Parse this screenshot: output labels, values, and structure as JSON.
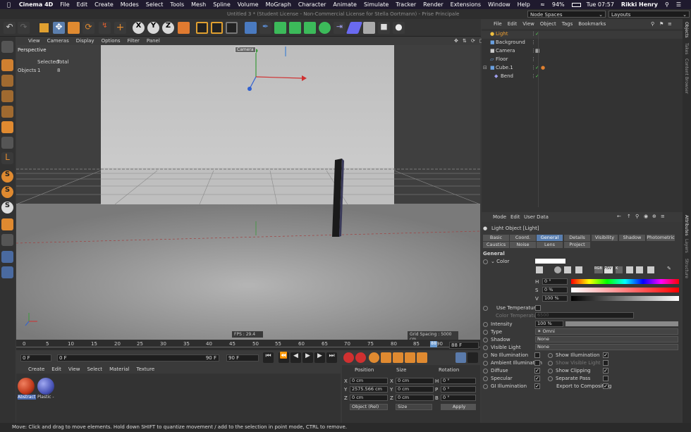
{
  "macmenu": {
    "apple": "",
    "app": "Cinema 4D",
    "items": [
      "File",
      "Edit",
      "Create",
      "Modes",
      "Select",
      "Tools",
      "Mesh",
      "Spline",
      "Volume",
      "MoGraph",
      "Character",
      "Animate",
      "Simulate",
      "Tracker",
      "Render",
      "Extensions",
      "Window",
      "Help"
    ],
    "battery": "94%",
    "clock": "Tue 07:57",
    "user": "Rikki Henry"
  },
  "window": {
    "title": "Untitled 3 * (Student License - Non-Commercial License for Stella Oortmann) - Prise Principale",
    "node_spaces": "Node Spaces",
    "layouts": "Layouts"
  },
  "viewport": {
    "menu": [
      "View",
      "Cameras",
      "Display",
      "Options",
      "Filter",
      "Panel"
    ],
    "label": "Perspective",
    "camera_tag": "Camera",
    "stats_header_selected": "Selected",
    "stats_header_total": "Total",
    "stats_row_label": "Objects",
    "stats_selected": "1",
    "stats_total": "8",
    "fps": "FPS : 29.4",
    "grid": "Grid Spacing : 5000 cm"
  },
  "timeline": {
    "ticks": [
      "0",
      "5",
      "10",
      "15",
      "20",
      "25",
      "30",
      "35",
      "40",
      "45",
      "50",
      "55",
      "60",
      "65",
      "70",
      "75",
      "80",
      "85",
      "88",
      "90"
    ],
    "current_badge": "88 F",
    "start": "0 F",
    "start2": "0 F",
    "end": "90 F",
    "end2": "90 F"
  },
  "materials": {
    "menu": [
      "Create",
      "Edit",
      "View",
      "Select",
      "Material",
      "Texture"
    ],
    "items": [
      {
        "name": "Abstract",
        "color": "#c0391b"
      },
      {
        "name": "Plastic -",
        "color": "#4a55b8"
      }
    ]
  },
  "coords": {
    "headers": [
      "Position",
      "Size",
      "Rotation"
    ],
    "rows": [
      {
        "a": "X",
        "pos": "0 cm",
        "b": "X",
        "size": "0 cm",
        "c": "H",
        "rot": "0 °"
      },
      {
        "a": "Y",
        "pos": "2575.566 cm",
        "b": "Y",
        "size": "0 cm",
        "c": "P",
        "rot": "0 °"
      },
      {
        "a": "Z",
        "pos": "0 cm",
        "b": "Z",
        "size": "0 cm",
        "c": "B",
        "rot": "0 °"
      }
    ],
    "mode": "Object (Rel)",
    "size_mode": "Size",
    "apply": "Apply"
  },
  "status": "Move: Click and drag to move elements. Hold down SHIFT to quantize movement / add to the selection in point mode, CTRL to remove.",
  "objects": {
    "menu": [
      "File",
      "Edit",
      "View",
      "Object",
      "Tags",
      "Bookmarks"
    ],
    "items": [
      {
        "name": "Light",
        "indent": 0,
        "selected": true,
        "color": "#f0c040"
      },
      {
        "name": "Background",
        "indent": 0,
        "color": "#6aa0e0"
      },
      {
        "name": "Camera",
        "indent": 0,
        "color": "#cccccc"
      },
      {
        "name": "Floor",
        "indent": 0,
        "color": "#6aa0e0"
      },
      {
        "name": "Cube.1",
        "indent": 0,
        "color": "#6aa0e0"
      },
      {
        "name": "Bend",
        "indent": 1,
        "color": "#a0a0f0"
      }
    ]
  },
  "attributes": {
    "menu": [
      "Mode",
      "Edit",
      "User Data"
    ],
    "object_title": "Light Object [Light]",
    "tabs_row1": [
      "Basic",
      "Coord.",
      "General",
      "Details",
      "Visibility",
      "Shadow",
      "Photometric"
    ],
    "tabs_row2": [
      "Caustics",
      "Noise",
      "Lens",
      "Project"
    ],
    "active_tab": "General",
    "section": "General",
    "color_label": "Color",
    "hsv": [
      {
        "k": "H",
        "v": "0 °"
      },
      {
        "k": "S",
        "v": "0 %"
      },
      {
        "k": "V",
        "v": "100 %"
      }
    ],
    "use_temp": "Use Temperature",
    "color_temp": "Color Temperature",
    "color_temp_val": "6500",
    "intensity_label": "Intensity",
    "intensity_val": "100 %",
    "intensity_fraction": 1.0,
    "type_label": "Type",
    "type_val": "Omni",
    "shadow_label": "Shadow",
    "shadow_val": "None",
    "vis_label": "Visible Light",
    "vis_val": "None",
    "checks_left": [
      {
        "label": "No Illumination",
        "on": false
      },
      {
        "label": "Ambient Illumination",
        "on": false
      },
      {
        "label": "Diffuse",
        "on": true
      },
      {
        "label": "Specular",
        "on": true
      },
      {
        "label": "GI Illumination",
        "on": true
      }
    ],
    "checks_right": [
      {
        "label": "Show Illumination",
        "on": true
      },
      {
        "label": "Show Visible Light",
        "on": false
      },
      {
        "label": "Show Clipping",
        "on": true
      },
      {
        "label": "Separate Pass",
        "on": false
      },
      {
        "label": "Export to Compositing",
        "on": true
      }
    ]
  },
  "sidetabs": [
    "Objects",
    "Takes",
    "Content Browser",
    "Attributes",
    "Layers",
    "Structure"
  ]
}
